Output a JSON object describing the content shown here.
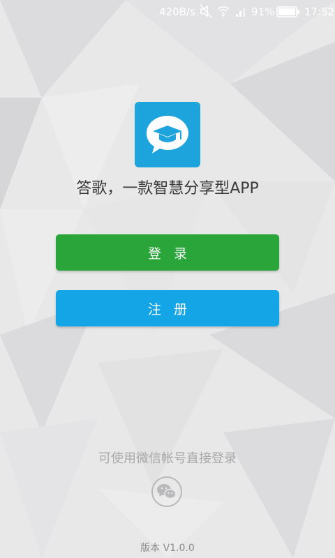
{
  "status_bar": {
    "network_speed": "420B/s",
    "battery_percent": "91%",
    "time": "17:52",
    "icons": [
      "mute-icon",
      "wifi-icon",
      "signal-icon",
      "battery-icon"
    ]
  },
  "app": {
    "logo_icon": "graduation-cap-chat-icon",
    "tagline": "答歌，一款智慧分享型APP"
  },
  "buttons": {
    "login_label": "登录",
    "register_label": "注册"
  },
  "wechat": {
    "hint": "可使用微信帐号直接登录",
    "icon": "wechat-icon"
  },
  "version": "版本 V1.0.0",
  "colors": {
    "login": "#2aa53a",
    "register": "#13a5e5",
    "logo_bg": "#1ea4dd"
  }
}
